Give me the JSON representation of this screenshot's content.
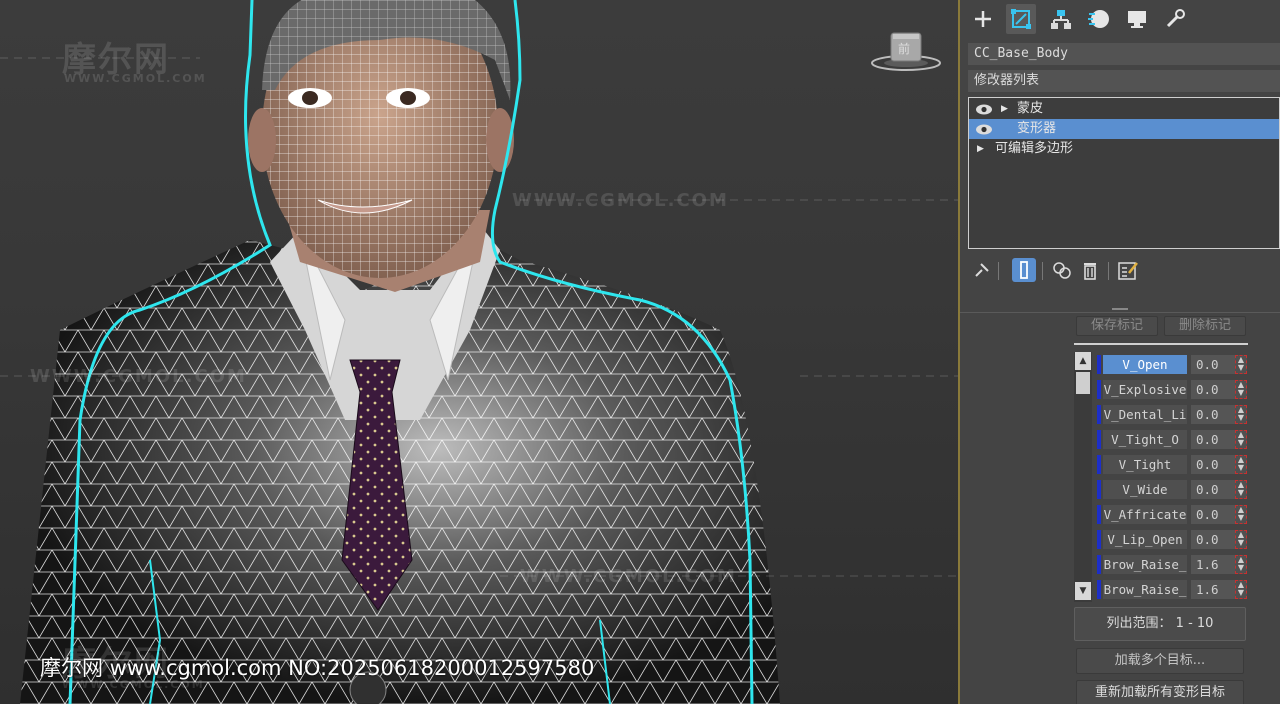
{
  "viewport": {
    "watermarks": [
      "摩尔网",
      "WWW.CGMOL.COM",
      "WWW.CGMOL.COM",
      "WWW.CGMOL.COM",
      "WWW.CGMOL.COM",
      "WWW.CGMOL.COM",
      "摩尔网"
    ],
    "viewcube_label": "前",
    "caption": "摩尔网 www.cgmol.com NO:20250618200012597580"
  },
  "panel": {
    "tabs": [
      {
        "icon": "create-icon",
        "active": false
      },
      {
        "icon": "modify-icon",
        "active": true
      },
      {
        "icon": "hierarchy-icon",
        "active": false
      },
      {
        "icon": "motion-icon",
        "active": false
      },
      {
        "icon": "display-icon",
        "active": false
      },
      {
        "icon": "utilities-icon",
        "active": false
      }
    ],
    "object_name": "CC_Base_Body",
    "modifier_list_label": "修改器列表",
    "stack": [
      {
        "label": "蒙皮",
        "eye": true,
        "arrow": true,
        "selected": false
      },
      {
        "label": "变形器",
        "eye": true,
        "arrow": false,
        "selected": true
      },
      {
        "label": "可编辑多边形",
        "eye": false,
        "arrow": true,
        "selected": false
      }
    ],
    "save_marker_label": "保存标记",
    "delete_marker_label": "删除标记",
    "channels": [
      {
        "name": "V_Open",
        "value": "0.0",
        "selected": true
      },
      {
        "name": "V_Explosive",
        "value": "0.0",
        "selected": false
      },
      {
        "name": "V_Dental_Li",
        "value": "0.0",
        "selected": false
      },
      {
        "name": "V_Tight_O",
        "value": "0.0",
        "selected": false
      },
      {
        "name": "V_Tight",
        "value": "0.0",
        "selected": false
      },
      {
        "name": "V_Wide",
        "value": "0.0",
        "selected": false
      },
      {
        "name": "V_Affricate",
        "value": "0.0",
        "selected": false
      },
      {
        "name": "V_Lip_Open",
        "value": "0.0",
        "selected": false
      },
      {
        "name": "Brow_Raise_",
        "value": "1.6",
        "selected": false
      },
      {
        "name": "Brow_Raise_",
        "value": "1.6",
        "selected": false
      }
    ],
    "range_label": "列出范围： 1 - 10",
    "load_targets_label": "加载多个目标...",
    "reload_targets_label": "重新加载所有变形目标"
  }
}
